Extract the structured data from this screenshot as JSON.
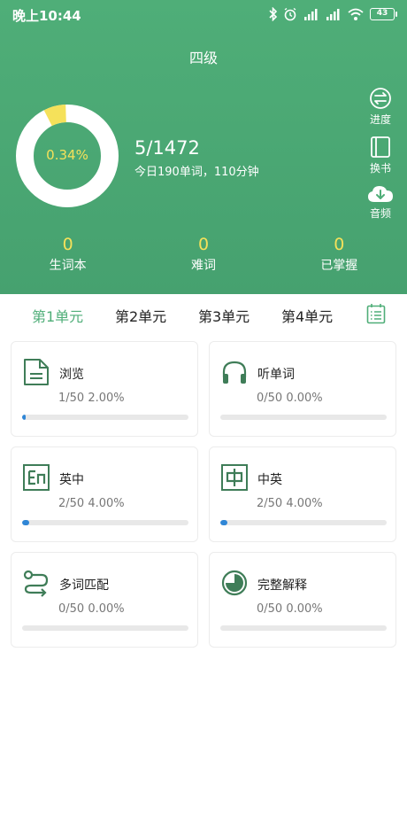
{
  "status_bar": {
    "time": "晚上10:44",
    "battery": "43"
  },
  "header": {
    "title": "四级",
    "progress_percent_label": "0.34%",
    "progress_fraction": 0.0034,
    "progress_count": "5/1472",
    "daily_plan": "今日190单词，110分钟",
    "side_actions": [
      {
        "label": "进度",
        "icon": "progress-icon"
      },
      {
        "label": "换书",
        "icon": "book-icon"
      },
      {
        "label": "音频",
        "icon": "cloud-download-icon"
      }
    ],
    "stats": [
      {
        "value": "0",
        "label": "生词本"
      },
      {
        "value": "0",
        "label": "难词"
      },
      {
        "value": "0",
        "label": "已掌握"
      }
    ]
  },
  "tabs": [
    {
      "label": "第1单元",
      "active": true
    },
    {
      "label": "第2单元",
      "active": false
    },
    {
      "label": "第3单元",
      "active": false
    },
    {
      "label": "第4单元",
      "active": false
    }
  ],
  "cards": [
    {
      "title": "浏览",
      "stats": "1/50  2.00%",
      "fraction": 0.02,
      "icon": "document-icon"
    },
    {
      "title": "听单词",
      "stats": "0/50  0.00%",
      "fraction": 0.0,
      "icon": "headphones-icon"
    },
    {
      "title": "英中",
      "stats": "2/50  4.00%",
      "fraction": 0.04,
      "icon": "en-icon"
    },
    {
      "title": "中英",
      "stats": "2/50  4.00%",
      "fraction": 0.04,
      "icon": "zhong-icon"
    },
    {
      "title": "多词匹配",
      "stats": "0/50  0.00%",
      "fraction": 0.0,
      "icon": "match-icon"
    },
    {
      "title": "完整解释",
      "stats": "0/50  0.00%",
      "fraction": 0.0,
      "icon": "pie-icon"
    }
  ],
  "colors": {
    "header_green": "#4fae78",
    "accent_yellow": "#f5e15a",
    "active_tab": "#4fae78",
    "progress_blue": "#2f86d6",
    "icon_green": "#3f7d58"
  }
}
